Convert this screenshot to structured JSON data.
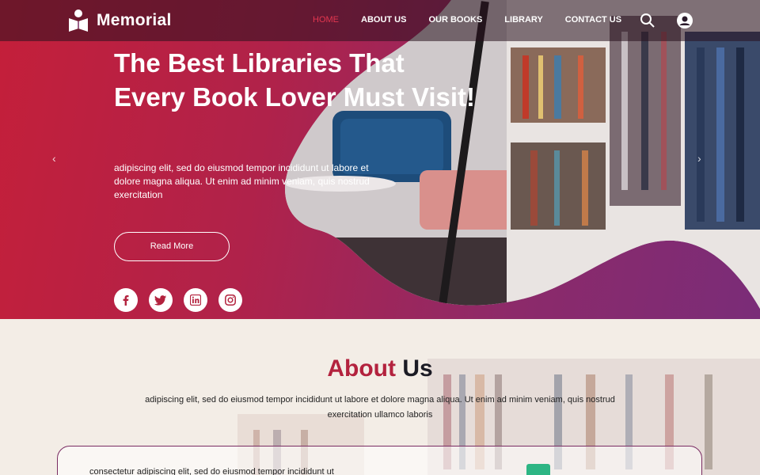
{
  "brand": {
    "name": "Memorial"
  },
  "nav": {
    "items": [
      {
        "label": "HOME",
        "active": true
      },
      {
        "label": "ABOUT US"
      },
      {
        "label": "OUR BOOKS"
      },
      {
        "label": "LIBRARY"
      },
      {
        "label": "CONTACT US"
      }
    ],
    "search_icon": "search-icon",
    "user_icon": "user-icon"
  },
  "hero": {
    "headline": "The Best Libraries That Every Book Lover Must Visit!",
    "lede": "adipiscing elit, sed do eiusmod tempor incididunt ut labore et dolore magna aliqua. Ut enim ad minim veniam, quis nostrud exercitation",
    "cta_label": "Read More",
    "prev_arrow": "‹",
    "next_arrow": "›",
    "socials": [
      "facebook-icon",
      "twitter-icon",
      "linkedin-icon",
      "instagram-icon"
    ]
  },
  "about": {
    "title_part1": "About",
    "title_part2": "Us",
    "text": "adipiscing elit, sed do eiusmod tempor incididunt ut labore et dolore magna aliqua. Ut enim ad minim veniam, quis nostrud exercitation ullamco laboris",
    "card_text": "consectetur adipiscing elit, sed do eiusmod tempor incididunt ut"
  },
  "colors": {
    "accent": "#c41f3a",
    "purple": "#7a2c78",
    "nav_active": "#e2364f",
    "title_dark": "#1b1b24"
  }
}
